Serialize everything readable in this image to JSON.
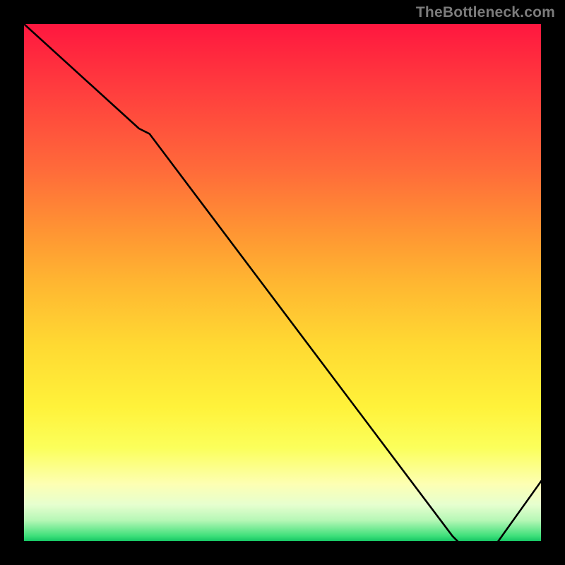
{
  "attribution": "TheBottleneck.com",
  "chart_data": {
    "type": "line",
    "title": "",
    "xlabel": "",
    "ylabel": "",
    "x": [
      0.0,
      0.22,
      0.24,
      0.82,
      0.84,
      0.9,
      1.0
    ],
    "values": [
      100,
      80,
      79,
      2,
      0,
      0,
      14
    ],
    "ylim": [
      0,
      100
    ],
    "xlim": [
      0,
      1
    ],
    "annotations": [
      {
        "text": "",
        "x": 0.85,
        "y": 1
      }
    ],
    "notes": "Gradient background runs red (top, high bottleneck) to green (bottom, low bottleneck). Black curve traces a performance/bottleneck metric dropping from 100 at the left edge to 0 near x≈0.85 then rising to ≈14 at the right edge."
  },
  "trough_label": "",
  "colors": {
    "top": "#ff173f",
    "mid": "#ffd932",
    "bottom": "#17c765",
    "line": "#000000",
    "attribution": "#7b7b7b",
    "trough_label": "#ff3a2e"
  }
}
